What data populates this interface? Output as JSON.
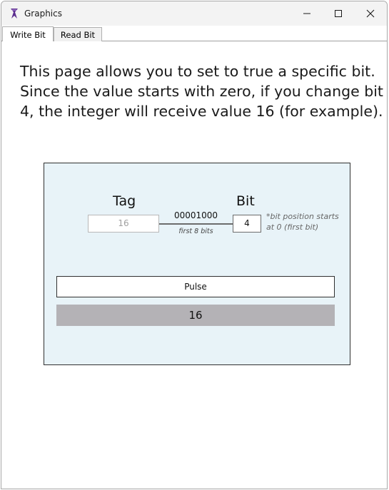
{
  "window": {
    "title": "Graphics",
    "icon": "app-icon"
  },
  "tabs": [
    {
      "label": "Write Bit",
      "selected": true
    },
    {
      "label": "Read Bit",
      "selected": false
    }
  ],
  "description": "This page allows you to set to true a specific bit. Since the value starts with zero, if you change bit 4, the integer will receive value 16 (for example).",
  "panel": {
    "tag_label": "Tag",
    "bit_label": "Bit",
    "tag_placeholder": "16",
    "binary_value": "00001000",
    "bits_caption": "first 8 bits",
    "bit_value": "4",
    "bit_note": "*bit position starts at 0 (first bit)",
    "pulse_label": "Pulse",
    "result_value": "16"
  },
  "colors": {
    "panel_bg": "#e8f3f8",
    "result_bg": "#b4b2b6"
  }
}
